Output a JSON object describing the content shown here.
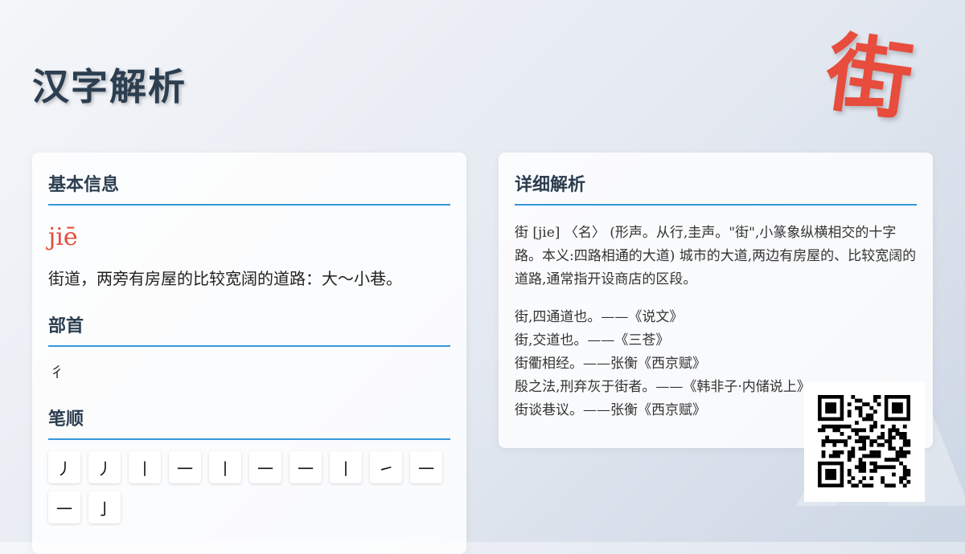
{
  "page": {
    "title": "汉字解析",
    "character": "街"
  },
  "basic": {
    "title": "基本信息",
    "pinyin": "jiē",
    "definition": "街道，两旁有房屋的比较宽阔的道路：大～小巷。"
  },
  "radical": {
    "title": "部首",
    "value": "彳"
  },
  "strokes": {
    "title": "笔顺",
    "items": [
      "丿",
      "丿",
      "丨",
      "一",
      "丨",
      "一",
      "一",
      "丨",
      "㇀",
      "一",
      "一",
      "亅"
    ]
  },
  "detail": {
    "title": "详细解析",
    "text": "街 [jie] 〈名〉 (形声。从行,圭声。\"街\",小篆象纵横相交的十字路。本义:四路相通的大道) 城市的大道,两边有房屋的、比较宽阔的道路,通常指开设商店的区段。",
    "quotes": [
      "街,四通道也。——《说文》",
      "街,交道也。——《三苍》",
      "街衢相经。——张衡《西京赋》",
      "殷之法,刑弃灰于街者。——《韩非子·内储说上》",
      "街谈巷议。——张衡《西京赋》"
    ]
  },
  "colors": {
    "accent": "#3498db",
    "character": "#e74c3c",
    "title": "#2c3e50"
  }
}
